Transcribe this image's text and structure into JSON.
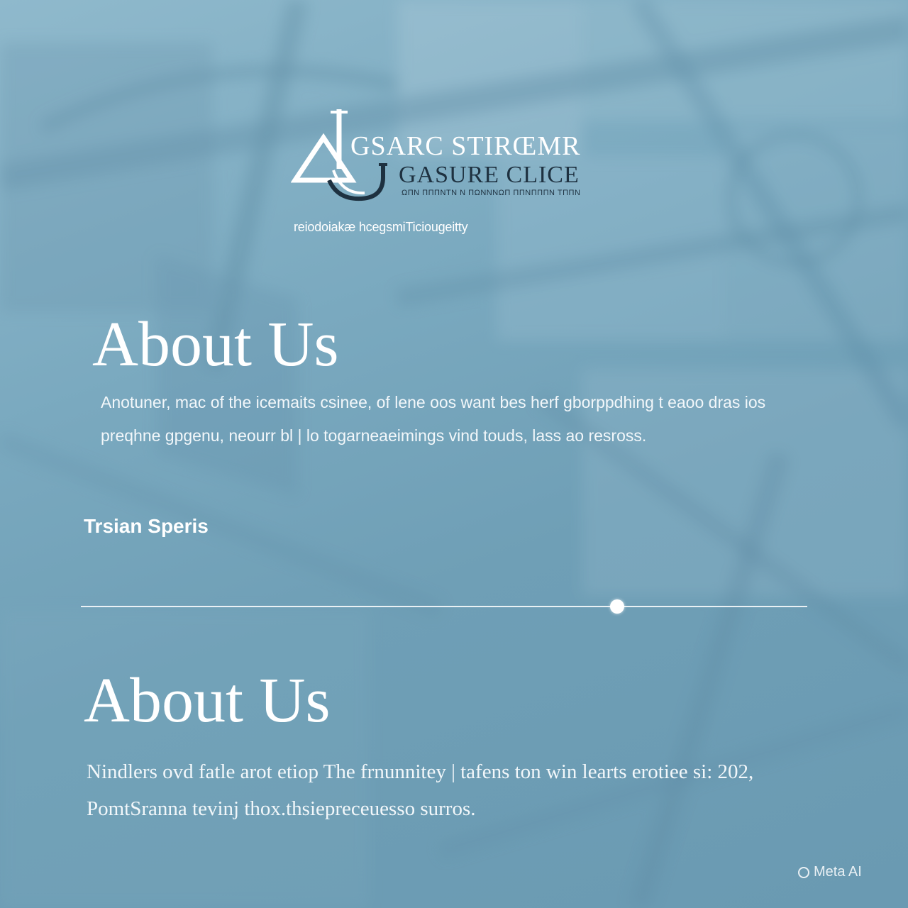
{
  "logo": {
    "line1": "GSARC STIRŒMR",
    "line2": "GASURE CLICE",
    "line3": "ΩΠΝ ΠΠΠΝΤΝ Ν ΠΩΝΝΝΩΠ ΠΠΝΠΠΠΝ ΤΠΠΝ",
    "tagline": "reiodoiakæ hcegsmiTiciougeitty",
    "mark_color": "#ffffff",
    "accent_color": "#1e3140"
  },
  "section1": {
    "heading": "About Us",
    "paragraph": "Anotuner, mac of the icemaits csinee, of lene oos want bes herf gborppdhing t eaoo dras ios preqhne gpgenu, neourr bl | lo togarneaeimings vind touds, lass ao resross.",
    "author": "Trsian Speris"
  },
  "divider": {
    "marker_position": 0.738
  },
  "section2": {
    "heading": "About Us",
    "paragraph": "Nindlers ovd fatle arot etiop The frnunnitey | tafens ton win learts erotiee si: 202, PomtSranna tevinj thox.thsiepreceuesso surros."
  },
  "watermark": {
    "label": "Meta AI",
    "icon": "ring-icon"
  },
  "colors": {
    "background": "#7aaac0",
    "text": "#ffffff"
  }
}
